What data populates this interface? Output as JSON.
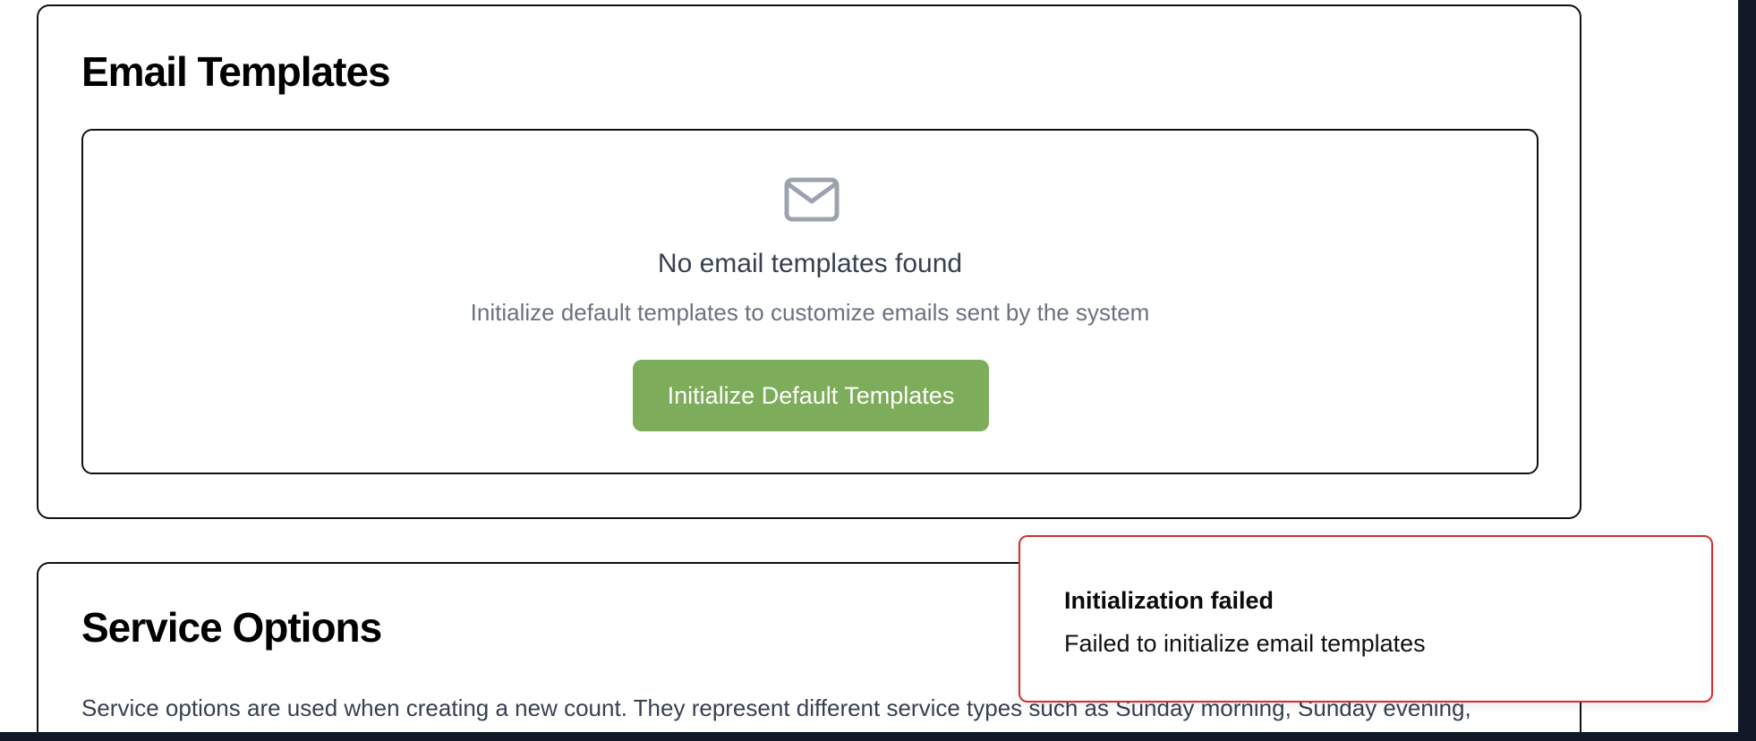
{
  "email_templates": {
    "title": "Email Templates",
    "empty_state": {
      "icon": "mail-icon",
      "title": "No email templates found",
      "subtitle": "Initialize default templates to customize emails sent by the system",
      "button_label": "Initialize Default Templates"
    }
  },
  "service_options": {
    "title": "Service Options",
    "description": "Service options are used when creating a new count. They represent different service types such as Sunday morning, Sunday evening, Wednesday night, etc."
  },
  "toast": {
    "title": "Initialization failed",
    "message": "Failed to initialize email templates",
    "border_color": "#d32f2f"
  },
  "colors": {
    "primary_button": "#7dad5b",
    "toast_error": "#d32f2f"
  }
}
